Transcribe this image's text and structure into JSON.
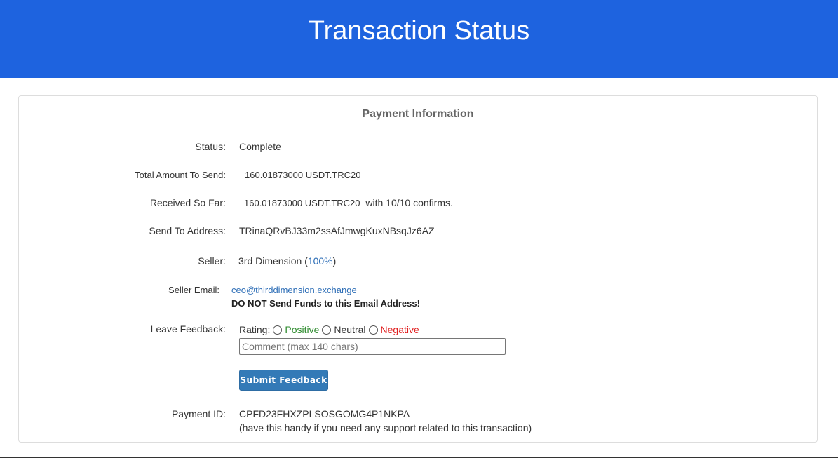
{
  "header": {
    "title": "Transaction Status"
  },
  "panel": {
    "title": "Payment Information"
  },
  "rows": {
    "status": {
      "label": "Status:",
      "value": "Complete"
    },
    "total": {
      "label": "Total Amount To Send:",
      "value": "160.01873000 USDT.TRC20"
    },
    "received": {
      "label": "Received So Far:",
      "value": "160.01873000 USDT.TRC20",
      "suffix": "with 10/10 confirms."
    },
    "address": {
      "label": "Send To Address:",
      "value": "TRinaQRvBJ33m2ssAfJmwgKuxNBsqJz6AZ"
    },
    "seller": {
      "label": "Seller:",
      "name": "3rd Dimension",
      "open_paren": "(",
      "rating": "100%",
      "close_paren": ")"
    },
    "seller_email": {
      "label": "Seller Email:",
      "email": "ceo@thirddimension.exchange",
      "warning": "DO NOT Send Funds to this Email Address!"
    },
    "feedback": {
      "label": "Leave Feedback:",
      "rating_label": "Rating:",
      "positive": "Positive",
      "neutral": "Neutral",
      "negative": "Negative",
      "comment_placeholder": "Comment (max 140 chars)",
      "submit_label": "Submit Feedback"
    },
    "payment_id": {
      "label": "Payment ID:",
      "value": "CPFD23FHXZPLSOSGOMG4P1NKPA",
      "note": "(have this handy if you need any support related to this transaction)"
    }
  },
  "colors": {
    "header_bg": "#1e63df",
    "link": "#2f6fb7",
    "positive": "#2e8b2e",
    "negative": "#e02020",
    "button_bg": "#337ab7"
  }
}
